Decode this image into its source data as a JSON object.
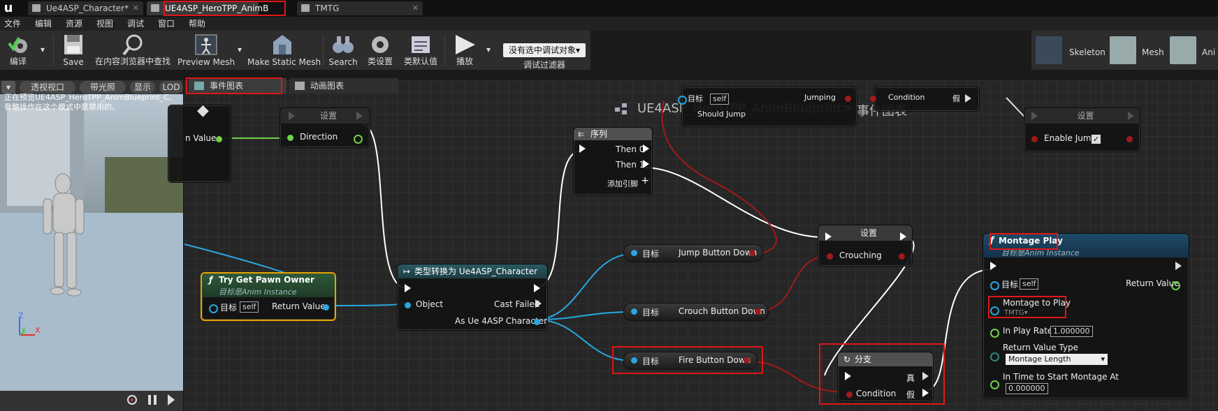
{
  "tabs": [
    {
      "label": "Ue4ASP_Character*"
    },
    {
      "label": "UE4ASP_HeroTPP_AnimB"
    },
    {
      "label": "TMTG"
    }
  ],
  "menu": [
    "文件",
    "编辑",
    "资源",
    "视图",
    "调试",
    "窗口",
    "帮助"
  ],
  "toolbar": {
    "compile": "编译",
    "save": "Save",
    "find_in_cb": "在内容浏览器中查找",
    "preview_mesh": "Preview Mesh",
    "make_static_mesh": "Make Static Mesh",
    "search": "Search",
    "class_settings": "类设置",
    "class_defaults": "类默认值",
    "play": "播放",
    "debug_object": "没有选中调试对象▾",
    "debug_filter": "调试过滤器"
  },
  "asset_bar": {
    "skeleton": "Skeleton",
    "mesh": "Mesh",
    "anim": "Ani"
  },
  "viewport": {
    "btn_perspective": "透视视口",
    "btn_lit": "带光照",
    "btn_show": "显示",
    "btn_lod": "LOD",
    "msg_line1": "正在预览UE4ASP_HeroTPP_AnimBlueprint_C,",
    "msg_line2": "骨骼操作在这个模式中是禁用的。",
    "axis_z": "Z",
    "axis_y": "Y",
    "axis_x": "X"
  },
  "graph_tabs": {
    "event_graph": "事件图表",
    "anim_graph": "动画图表"
  },
  "breadcrumb": {
    "blueprint": "UE4ASP_HeroTPP_AnimBlueprint",
    "sep": ">",
    "graph": "事件图表"
  },
  "nodes": {
    "set_direction": {
      "title": "设置",
      "in_value": "n Value",
      "pin": "Direction"
    },
    "sequence": {
      "title": "序列",
      "then0": "Then 0",
      "then1": "Then 1",
      "add_pin": "添加引脚"
    },
    "top_partial": {
      "target": "目标",
      "self": "self",
      "jumping": "Jumping",
      "should_jump": "Should Jump",
      "condition": "Condition",
      "false_label": "假"
    },
    "set_enable_jump": {
      "title": "设置",
      "pin": "Enable Jump"
    },
    "set_crouching": {
      "title": "设置",
      "pin": "Crouching"
    },
    "try_get_pawn": {
      "title": "Try Get Pawn Owner",
      "subtitle": "目标是Anim Instance",
      "target": "目标",
      "self": "self",
      "return_value": "Return Value"
    },
    "cast": {
      "title": "类型转换为 Ue4ASP_Character",
      "object": "Object",
      "cast_failed": "Cast Failed",
      "as_char": "As Ue 4ASP Character"
    },
    "jump_btn": {
      "target": "目标",
      "label": "Jump Button Down"
    },
    "crouch_btn": {
      "target": "目标",
      "label": "Crouch Button Down"
    },
    "fire_btn": {
      "target": "目标",
      "label": "Fire Button Down"
    },
    "branch": {
      "title": "分支",
      "true_label": "真",
      "condition": "Condition",
      "false_label": "假"
    },
    "montage_play": {
      "title": "Montage Play",
      "subtitle": "目标是Anim Instance",
      "target": "目标",
      "self": "self",
      "return_value": "Return Value",
      "montage_to_play": "Montage to Play",
      "montage_value": "TMTG▾",
      "in_play_rate": "In Play Rate",
      "play_rate_value": "1.000000",
      "return_value_type": "Return Value Type",
      "rvt_value": "Montage Length",
      "in_time_to_start": "In Time to Start Montage At",
      "start_value": "0.000000"
    }
  }
}
